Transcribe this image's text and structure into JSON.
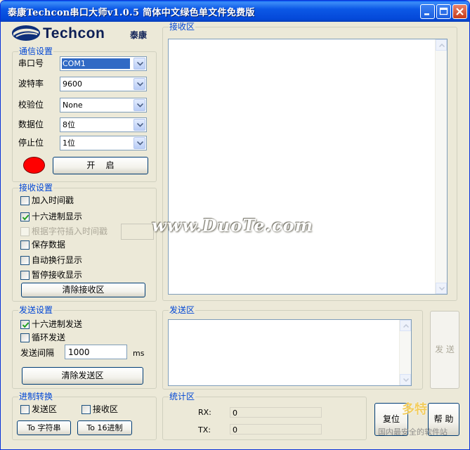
{
  "window": {
    "title": "泰康Techcon串口大师v1.0.5 简体中文绿色单文件免费版",
    "controls": [
      "minimize",
      "maximize",
      "close"
    ]
  },
  "logo": {
    "brand": "Techcon",
    "brand_cn": "泰康"
  },
  "comm_settings": {
    "title": "通信设置",
    "port_label": "串口号",
    "port_value": "COM1",
    "baud_label": "波特率",
    "baud_value": "9600",
    "parity_label": "校验位",
    "parity_value": "None",
    "databits_label": "数据位",
    "databits_value": "8位",
    "stopbits_label": "停止位",
    "stopbits_value": "1位",
    "status_color": "#ff0000",
    "open_button": "开    启"
  },
  "recv_settings": {
    "title": "接收设置",
    "add_timestamp": {
      "label": "加入时间戳",
      "checked": false
    },
    "hex_display": {
      "label": "十六进制显示",
      "checked": true
    },
    "char_timestamp": {
      "label": "根据字符插入时间戳",
      "checked": false,
      "disabled": true
    },
    "save_data": {
      "label": "保存数据",
      "checked": false
    },
    "auto_newline": {
      "label": "自动换行显示",
      "checked": false
    },
    "pause_display": {
      "label": "暂停接收显示",
      "checked": false
    },
    "clear_button": "清除接收区"
  },
  "send_settings": {
    "title": "发送设置",
    "hex_send": {
      "label": "十六进制发送",
      "checked": true
    },
    "loop_send": {
      "label": "循环发送",
      "checked": false
    },
    "interval_label": "发送间隔",
    "interval_value": "1000",
    "interval_unit": "ms",
    "clear_button": "清除发送区"
  },
  "convert": {
    "title": "进制转换",
    "send_area": {
      "label": "发送区",
      "checked": false
    },
    "recv_area": {
      "label": "接收区",
      "checked": false
    },
    "to_string_button": "To 字符串",
    "to_hex_button": "To 16进制"
  },
  "recv_area": {
    "title": "接收区",
    "content": ""
  },
  "send_area": {
    "title": "发送区",
    "content": "",
    "send_button": "发 送"
  },
  "stats": {
    "title": "统计区",
    "rx_label": "RX:",
    "rx_value": "0",
    "tx_label": "TX:",
    "tx_value": "0"
  },
  "buttons": {
    "reset": "复位",
    "help": "帮 助"
  },
  "watermarks": {
    "duote": "www.DuoTe.com",
    "corner_line1": "多特",
    "corner_line2": "国内最安全的软件站"
  },
  "accent_color": "#0046d5"
}
